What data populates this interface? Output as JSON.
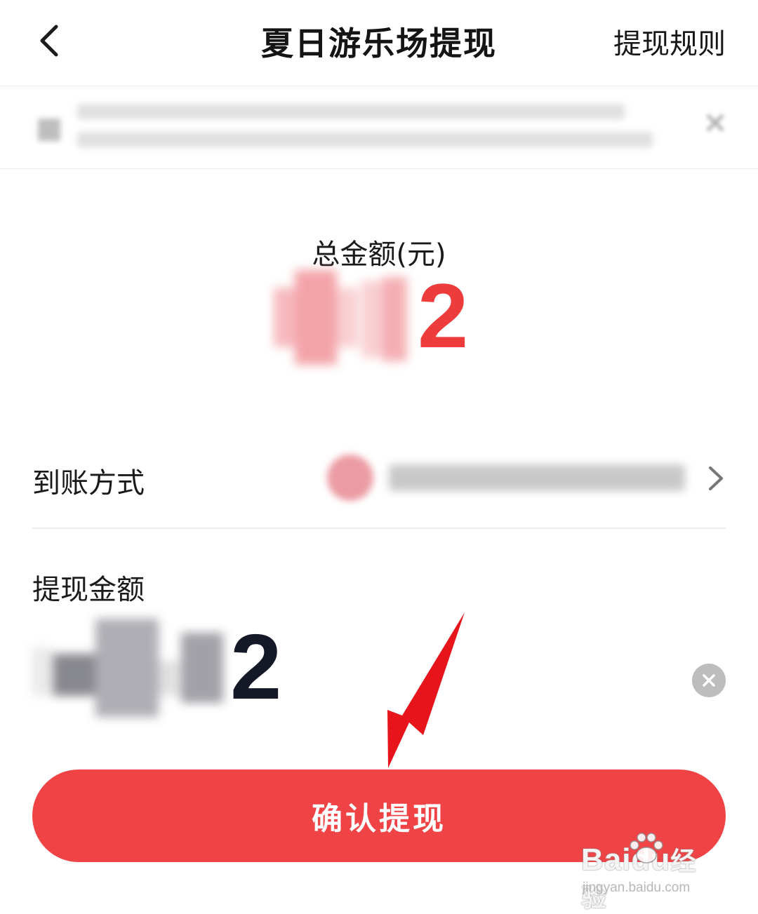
{
  "header": {
    "title": "夏日游乐场提现",
    "rules_link": "提现规则"
  },
  "summary": {
    "total_label": "总金额(元)",
    "total_amount_visible": "2"
  },
  "payout": {
    "label": "到账方式"
  },
  "withdraw": {
    "label": "提现金额",
    "amount_visible": "2"
  },
  "confirm": {
    "label": "确认提现"
  },
  "watermark": {
    "brand_a": "Bai",
    "brand_b": "du",
    "brand_c": "经验",
    "url": "jingyan.baidu.com"
  },
  "colors": {
    "accent_red": "#ef4346",
    "amount_red": "#ee3b3b",
    "arrow_red": "#e8141c",
    "text_dark": "#151826",
    "clear_grey": "#bdbdbd"
  },
  "icons": {
    "back": "chevron-left-icon",
    "close": "close-icon",
    "chevron": "chevron-right-icon",
    "clear": "clear-icon"
  }
}
